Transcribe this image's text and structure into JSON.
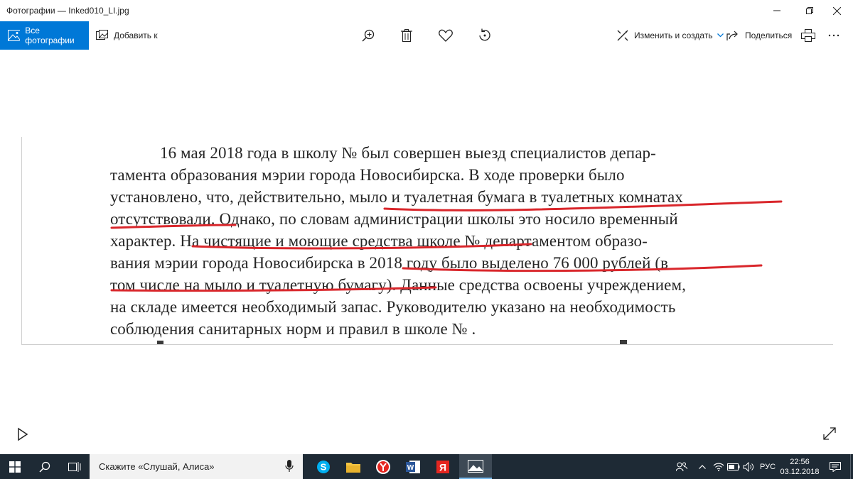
{
  "window": {
    "title": "Фотографии — Inked010_LI.jpg"
  },
  "toolbar": {
    "all_photos_label": "Все фотографии",
    "add_to_label": "Добавить к",
    "edit_create_label": "Изменить и создать",
    "share_label": "Поделиться",
    "icons": [
      "zoom-icon",
      "delete-icon",
      "favorite-icon",
      "rotate-icon",
      "print-icon",
      "more-icon"
    ]
  },
  "document": {
    "lines": [
      "16 мая 2018 года в школу №        был совершен выезд специалистов депар-",
      "тамента образования мэрии города Новосибирска. В ходе проверки было",
      "установлено, что, действительно, мыло и туалетная бумага в туалетных комнатах",
      "отсутствовали. Однако, по словам администрации школы это носило временный",
      "характер. На чистящие и моющие средства школе №        департаментом образо-",
      "вания мэрии города Новосибирска в 2018 году было выделено 76 000 рублей (в",
      "том числе на мыло и туалетную бумагу). Данные средства освоены учреждением,",
      "на складе имеется необходимый запас. Руководителю указано на необходимость",
      "соблюдения санитарных норм и правил в школе №       ."
    ],
    "underline_color": "#d9262b"
  },
  "taskbar": {
    "search_placeholder": "Скажите «Слушай, Алиса»",
    "language": "РУС",
    "time": "22:56",
    "date": "03.12.2018"
  },
  "colors": {
    "accent": "#0078d7",
    "taskbar": "#1e2a35"
  }
}
